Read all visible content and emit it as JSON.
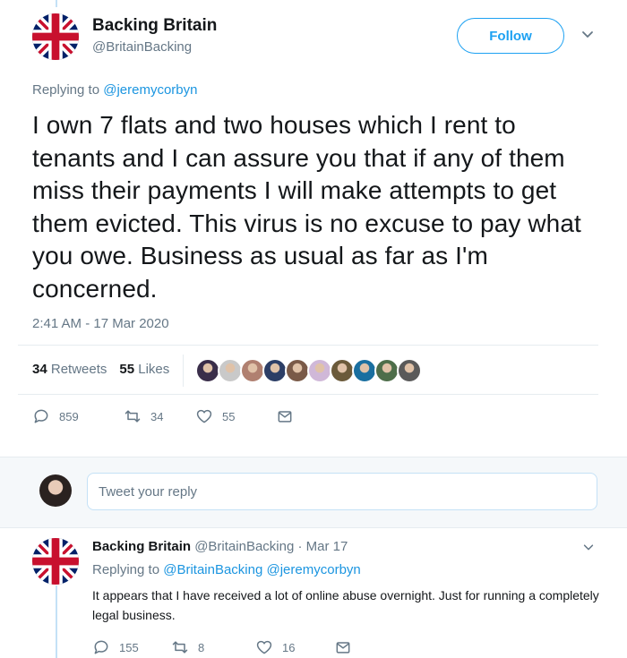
{
  "tweet": {
    "author_name": "Backing Britain",
    "author_handle": "@BritainBacking",
    "follow_label": "Follow",
    "replying_prefix": "Replying to ",
    "replying_to": "@jeremycorbyn",
    "text": "I own 7 flats and two houses which I rent to tenants and I can assure you that if any of them miss their payments I will make attempts to get them evicted. This virus is no excuse to pay what you owe. Business as usual as far as I'm concerned.",
    "timestamp": "2:41 AM - 17 Mar 2020",
    "retweets_count": "34",
    "retweets_label": "Retweets",
    "likes_count": "55",
    "likes_label": "Likes",
    "likers": [
      "#3a2e4a",
      "#c9c9c9",
      "#b08070",
      "#2c3e66",
      "#7a5a48",
      "#d0b8d8",
      "#6b5a3a",
      "#1a6fa0",
      "#4e6e4a",
      "#5a5a5a"
    ],
    "actions": {
      "replies": "859",
      "retweets": "34",
      "likes": "55"
    }
  },
  "reply_box": {
    "placeholder": "Tweet your reply"
  },
  "reply": {
    "author_name": "Backing Britain",
    "handle_and_date": "@BritainBacking · Mar 17",
    "replying_prefix": "Replying to ",
    "replying_to_1": "@BritainBacking",
    "replying_to_2": "@jeremycorbyn",
    "text": "It appears that I have received a lot of online abuse overnight. Just for running a completely legal business.",
    "actions": {
      "replies": "155",
      "retweets": "8",
      "likes": "16"
    }
  },
  "colors": {
    "accent": "#1da1f2",
    "link": "#1b95e0",
    "muted": "#657786",
    "text": "#14171a"
  },
  "icons": [
    "union-jack-icon",
    "chevron-down-icon",
    "reply-icon",
    "retweet-icon",
    "heart-icon",
    "mail-icon"
  ]
}
